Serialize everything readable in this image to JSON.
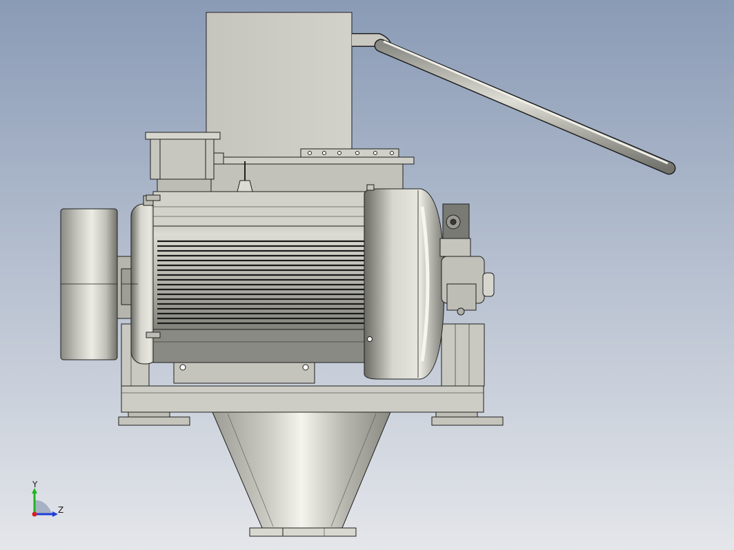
{
  "viewport": {
    "background_top": "#8a9bb6",
    "background_bottom": "#e4e6ea"
  },
  "model": {
    "metal_light": "#e0e0d8",
    "metal_mid": "#b9b9b0",
    "metal_dark": "#6c6c66",
    "edge_color": "#1e1e1e",
    "fin_color": "#2a2a2a"
  },
  "triad": {
    "y_label": "Y",
    "z_label": "Z",
    "y_color": "#1fb51f",
    "z_color": "#1f3fd8",
    "x_color": "#d81f1f"
  }
}
